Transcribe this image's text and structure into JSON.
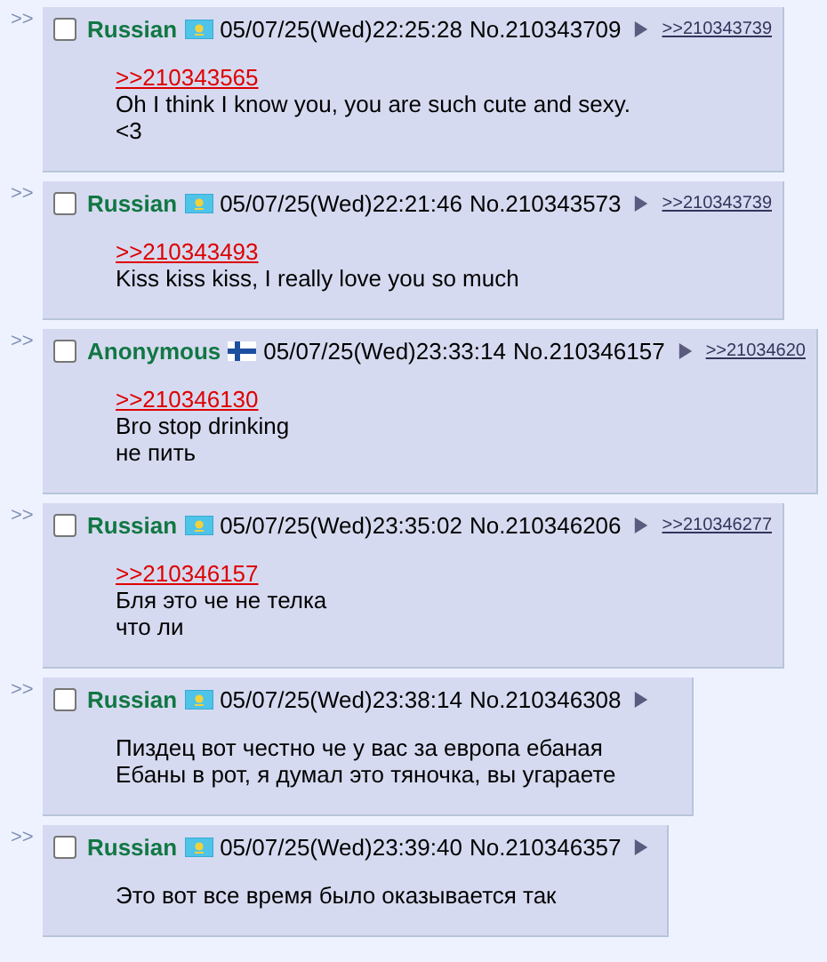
{
  "posts": [
    {
      "checked": false,
      "name": "Russian",
      "flag": {
        "kind": "kz"
      },
      "datetime": "05/07/25(Wed)22:25:28",
      "number": "No.210343709",
      "backlinks": [
        ">>210343739"
      ],
      "quote": ">>210343565",
      "lines": [
        "Oh I think I know you, you are such cute and sexy.",
        "<3"
      ]
    },
    {
      "checked": false,
      "name": "Russian",
      "flag": {
        "kind": "kz"
      },
      "datetime": "05/07/25(Wed)22:21:46",
      "number": "No.210343573",
      "backlinks": [
        ">>210343739"
      ],
      "quote": ">>210343493",
      "lines": [
        "Kiss kiss kiss, I really love you so much"
      ]
    },
    {
      "checked": false,
      "name": "Anonymous",
      "flag": {
        "kind": "fi"
      },
      "datetime": "05/07/25(Wed)23:33:14",
      "number": "No.210346157",
      "backlinks": [
        ">>21034620"
      ],
      "quote": ">>210346130",
      "lines": [
        "Bro stop drinking",
        "не пить"
      ]
    },
    {
      "checked": false,
      "name": "Russian",
      "flag": {
        "kind": "kz"
      },
      "datetime": "05/07/25(Wed)23:35:02",
      "number": "No.210346206",
      "backlinks": [
        ">>210346277"
      ],
      "quote": ">>210346157",
      "lines": [
        "Бля это че не телка",
        "что ли"
      ]
    },
    {
      "checked": false,
      "name": "Russian",
      "flag": {
        "kind": "kz"
      },
      "datetime": "05/07/25(Wed)23:38:14",
      "number": "No.210346308",
      "lines": [
        "Пиздец вот честно че у вас за европа ебаная",
        "Ебаны в рот, я думал это тяночка, вы угараете"
      ]
    },
    {
      "checked": false,
      "name": "Russian",
      "flag": {
        "kind": "kz"
      },
      "datetime": "05/07/25(Wed)23:39:40",
      "number": "No.210346357",
      "lines": [
        "Это вот все время было оказывается так"
      ]
    }
  ],
  "side_marker": ">>"
}
